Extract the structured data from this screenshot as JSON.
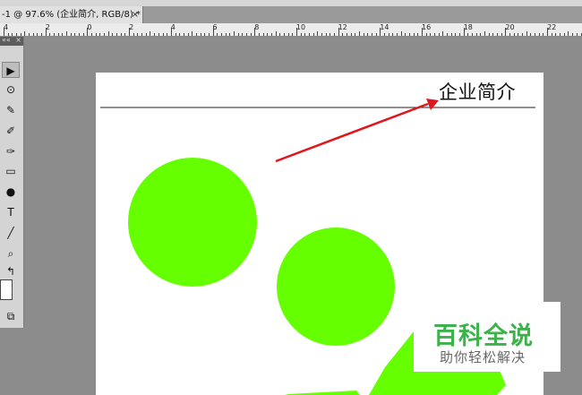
{
  "document_tab": {
    "title": "-1 @ 97.6% (企业简介, RGB/8) *",
    "close": "×"
  },
  "ruler": {
    "labels": [
      "4",
      "2",
      "0",
      "2",
      "4",
      "6",
      "8",
      "10",
      "12",
      "14",
      "16",
      "18",
      "20",
      "22"
    ]
  },
  "tools_panel": {
    "header_expand": "««",
    "header_close": "×",
    "tools": [
      {
        "name": "move-tool",
        "glyph": "▶"
      },
      {
        "name": "quick-selection-tool",
        "glyph": "⊙"
      },
      {
        "name": "eyedropper-tool",
        "glyph": "✎"
      },
      {
        "name": "brush-tool",
        "glyph": "✐"
      },
      {
        "name": "history-brush-tool",
        "glyph": "✑"
      },
      {
        "name": "gradient-tool",
        "glyph": "▭"
      },
      {
        "name": "burn-tool",
        "glyph": "●"
      },
      {
        "name": "type-tool",
        "glyph": "T"
      },
      {
        "name": "line-tool",
        "glyph": "╱"
      },
      {
        "name": "zoom-tool",
        "glyph": "⌕"
      },
      {
        "name": "swap-colors",
        "glyph": "↰"
      },
      {
        "name": "screen-mode",
        "glyph": "⧉"
      }
    ]
  },
  "canvas": {
    "heading": "企业简介",
    "circle_color": "#66ff00",
    "arrow_color": "#e0161c"
  },
  "watermark": {
    "main": "百科全说",
    "sub": "助你轻松解决",
    "color": "#3bb24a"
  }
}
